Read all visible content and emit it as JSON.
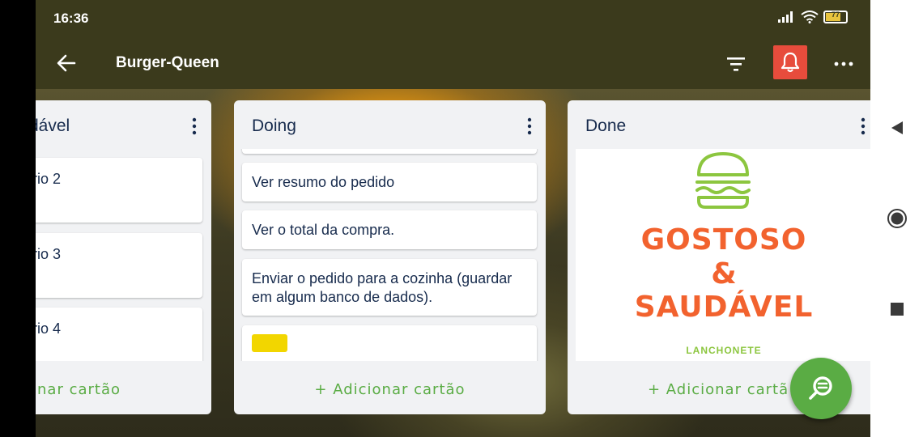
{
  "status_bar": {
    "time": "16:36",
    "battery": "77"
  },
  "app_bar": {
    "title": "Burger-Queen",
    "icons": [
      "back-arrow-icon",
      "filter-icon",
      "bell-icon",
      "more-icon"
    ]
  },
  "lists": {
    "left": {
      "title_partial": "dável",
      "cards": [
        "rio 2",
        "rio 3",
        "rio 4"
      ],
      "add_card_partial": "onar cartão"
    },
    "doing": {
      "title": "Doing",
      "cards": [
        "Ver resumo do pedido",
        "Ver o total da compra.",
        "Enviar o pedido para a cozinha (guardar em algum banco de dados)."
      ],
      "label_color": "#f2d600",
      "add_card": "+ Adicionar cartão"
    },
    "done": {
      "title": "Done",
      "logo": {
        "line1": "GOSTOSO",
        "line2": "&",
        "line3": "SAUDÁVEL",
        "sub": "LANCHONETE"
      },
      "add_card": "+ Adicionar cartã"
    }
  },
  "colors": {
    "app_bar": "#3b3a1c",
    "accent_green": "#5aac44",
    "notification_red": "#e74c3c",
    "logo_orange": "#f2622e",
    "logo_green": "#8cc63f"
  },
  "nav": {
    "icons": [
      "back-triangle-icon",
      "home-circle-icon",
      "recents-square-icon"
    ]
  }
}
